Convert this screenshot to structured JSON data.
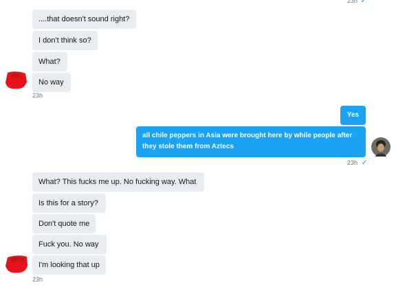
{
  "thread": {
    "top_timestamp": "23h",
    "group1": {
      "messages": [
        "....that doesn't sound right?",
        "I don't think so?",
        "What?",
        "No way"
      ],
      "timestamp": "23h"
    },
    "group2": {
      "messages": [
        "Yes",
        "all chile peppers in Asia were brought here by while people after they stole them from Aztecs"
      ],
      "timestamp": "23h"
    },
    "group3": {
      "messages": [
        "What? This fucks me up. No fucking way. What",
        "Is this for a story?",
        "Don't quote me",
        "Fuck you. No way",
        "I'm looking that up"
      ],
      "timestamp": "23h"
    }
  },
  "colors": {
    "incoming_bubble": "#e6ecf0",
    "outgoing_bubble": "#1da1f2",
    "timestamp_text": "#657786",
    "redaction": "#e8131a"
  },
  "icons": {
    "read_receipt": "checkmark-icon",
    "contact_avatar": "redacted-avatar",
    "user_avatar": "user-avatar"
  }
}
